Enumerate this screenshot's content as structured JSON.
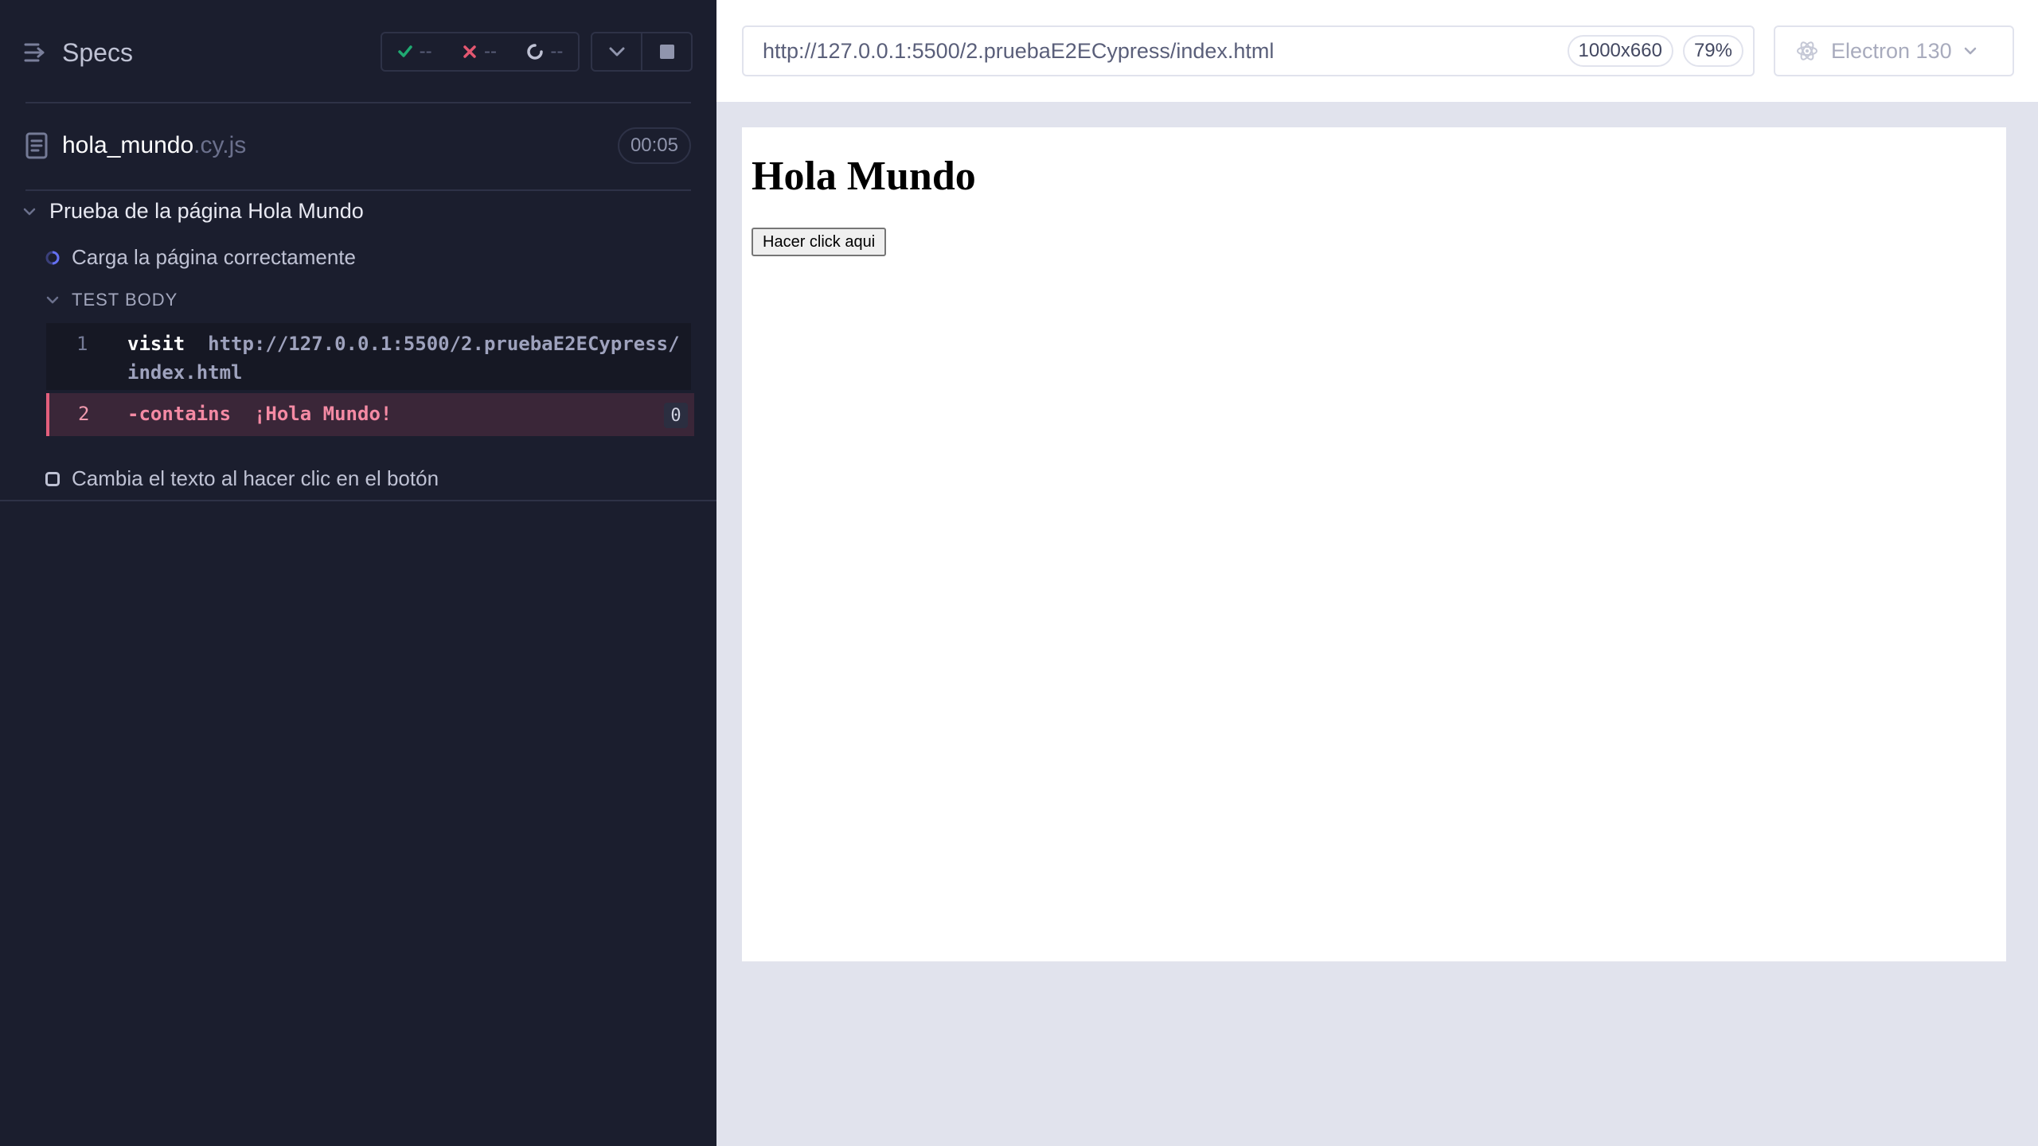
{
  "header": {
    "specs_label": "Specs",
    "stats": {
      "passed": "--",
      "failed": "--",
      "pending": "--"
    }
  },
  "spec": {
    "file_name": "hola_mundo",
    "file_ext": ".cy.js",
    "duration": "00:05"
  },
  "suite": {
    "title": "Prueba de la página Hola Mundo",
    "tests": [
      {
        "title": "Carga la página correctamente",
        "state": "running"
      },
      {
        "title": "Cambia el texto al hacer clic en el botón",
        "state": "pending"
      }
    ],
    "test_body_label": "TEST BODY",
    "commands": [
      {
        "num": "1",
        "name": "visit",
        "arg_line1": "http://127.0.0.1:5500/2.pruebaE2ECypress/",
        "arg_line2": "index.html"
      },
      {
        "num": "2",
        "name": "-contains",
        "arg": "¡Hola Mundo!",
        "count": "0"
      }
    ]
  },
  "browser_bar": {
    "url": "http://127.0.0.1:5500/2.pruebaE2ECypress/index.html",
    "viewport": "1000x660",
    "scale": "79%",
    "browser": "Electron 130"
  },
  "aut": {
    "heading": "Hola Mundo",
    "button": "Hacer click aqui"
  },
  "colors": {
    "sidebar_bg": "#1b1e2e",
    "passed": "#1fa971",
    "failed": "#e45770",
    "running": "#6470f3",
    "failed_row_bg": "#3a2638"
  }
}
